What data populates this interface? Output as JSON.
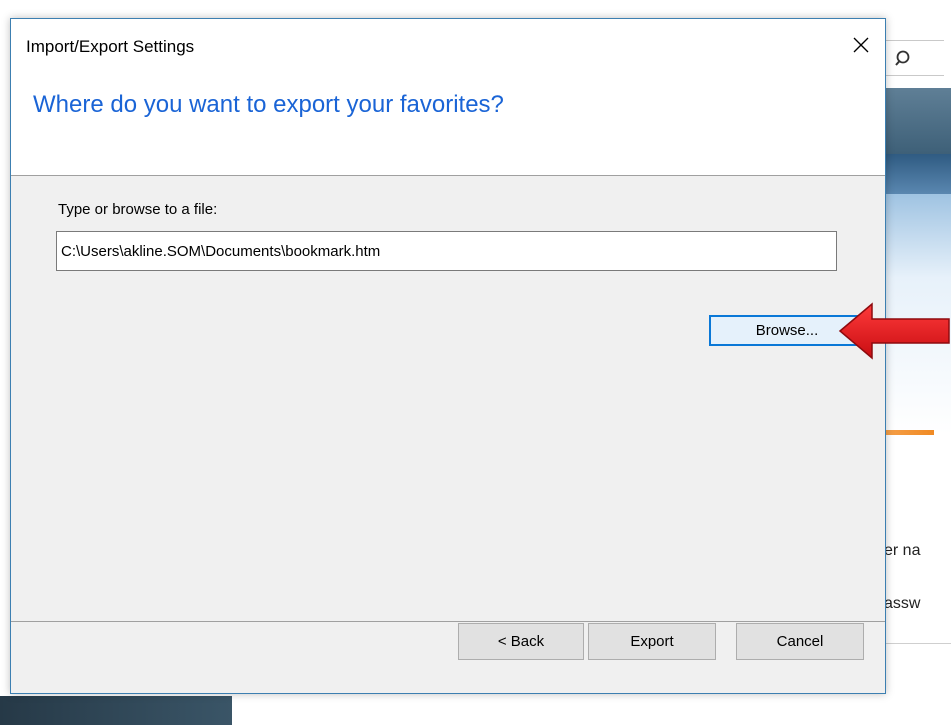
{
  "background": {
    "text_line_1": "er na",
    "text_line_2": "assw",
    "search_icon": "search-icon"
  },
  "dialog": {
    "title": "Import/Export Settings",
    "close_icon": "close-icon",
    "heading": "Where do you want to export your favorites?",
    "heading_color": "#1a64d6",
    "field_label": "Type or browse to a file:",
    "file_path": "C:\\Users\\akline.SOM\\Documents\\bookmark.htm",
    "browse_label": "Browse...",
    "back_label": "< Back",
    "export_label": "Export",
    "cancel_label": "Cancel"
  },
  "annotation": {
    "arrow_icon": "red-arrow-left-icon",
    "arrow_color": "#e8151b"
  }
}
